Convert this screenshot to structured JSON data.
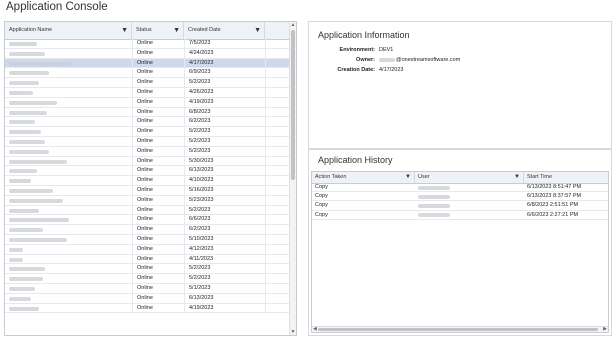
{
  "page_title": "Application Console",
  "grid": {
    "columns": {
      "name": "Application Name",
      "status": "Status",
      "created": "Created Date"
    },
    "selected_index": 2,
    "rows": [
      {
        "name_blur_w": 28,
        "status": "Online",
        "created": "7/5/2023"
      },
      {
        "name_blur_w": 36,
        "status": "Online",
        "created": "4/24/2023"
      },
      {
        "name_blur_w": 62,
        "status": "Online",
        "created": "4/17/2023"
      },
      {
        "name_blur_w": 40,
        "status": "Online",
        "created": "6/9/2023"
      },
      {
        "name_blur_w": 30,
        "status": "Online",
        "created": "5/2/2023"
      },
      {
        "name_blur_w": 24,
        "status": "Online",
        "created": "4/26/2023"
      },
      {
        "name_blur_w": 48,
        "status": "Online",
        "created": "4/19/2023"
      },
      {
        "name_blur_w": 38,
        "status": "Online",
        "created": "6/8/2023"
      },
      {
        "name_blur_w": 26,
        "status": "Online",
        "created": "6/2/2023"
      },
      {
        "name_blur_w": 32,
        "status": "Online",
        "created": "5/2/2023"
      },
      {
        "name_blur_w": 36,
        "status": "Online",
        "created": "5/2/2023"
      },
      {
        "name_blur_w": 40,
        "status": "Online",
        "created": "5/2/2023"
      },
      {
        "name_blur_w": 58,
        "status": "Online",
        "created": "5/30/2023"
      },
      {
        "name_blur_w": 28,
        "status": "Online",
        "created": "6/13/2023"
      },
      {
        "name_blur_w": 22,
        "status": "Online",
        "created": "4/10/2023"
      },
      {
        "name_blur_w": 44,
        "status": "Online",
        "created": "5/16/2023"
      },
      {
        "name_blur_w": 54,
        "status": "Online",
        "created": "5/23/2023"
      },
      {
        "name_blur_w": 30,
        "status": "Online",
        "created": "5/2/2023"
      },
      {
        "name_blur_w": 60,
        "status": "Online",
        "created": "6/6/2023"
      },
      {
        "name_blur_w": 34,
        "status": "Online",
        "created": "6/2/2023"
      },
      {
        "name_blur_w": 58,
        "status": "Online",
        "created": "5/10/2023"
      },
      {
        "name_blur_w": 14,
        "status": "Online",
        "created": "4/12/2023"
      },
      {
        "name_blur_w": 14,
        "status": "Online",
        "created": "4/11/2023"
      },
      {
        "name_blur_w": 36,
        "status": "Online",
        "created": "5/2/2023"
      },
      {
        "name_blur_w": 34,
        "status": "Online",
        "created": "5/2/2023"
      },
      {
        "name_blur_w": 26,
        "status": "Online",
        "created": "5/1/2023"
      },
      {
        "name_blur_w": 22,
        "status": "Online",
        "created": "6/13/2023"
      },
      {
        "name_blur_w": 30,
        "status": "Online",
        "created": "4/19/2023"
      }
    ]
  },
  "info": {
    "title": "Application Information",
    "environment_label": "Environment:",
    "environment_value": "DEV1",
    "owner_label": "Owner:",
    "owner_value": "@onestreamsoftware.com",
    "creation_label": "Creation Date:",
    "creation_value": "4/17/2023"
  },
  "history": {
    "title": "Application History",
    "columns": {
      "action": "Action Taken",
      "user": "User",
      "start": "Start Time"
    },
    "rows": [
      {
        "action": "Copy",
        "start": "6/13/2023 8:51:47 PM"
      },
      {
        "action": "Copy",
        "start": "6/13/2023 8:37:57 PM"
      },
      {
        "action": "Copy",
        "start": "6/8/2023 2:51:51 PM"
      },
      {
        "action": "Copy",
        "start": "6/6/2023 2:27:21 PM"
      }
    ]
  },
  "icons": {
    "filter": "filter-funnel-icon",
    "scroll_up": "arrow-up-icon",
    "scroll_down": "arrow-down-icon",
    "scroll_left": "arrow-left-icon",
    "scroll_right": "arrow-right-icon"
  },
  "colors": {
    "selected_row": "#cdd9ee",
    "header_bg": "#eef1f5"
  }
}
